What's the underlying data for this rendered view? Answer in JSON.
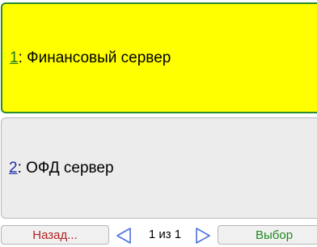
{
  "items": [
    {
      "number": "1",
      "separator": ":",
      "label": "Финансовый сервер",
      "selected": true
    },
    {
      "number": "2",
      "separator": ":",
      "label": "ОФД сервер",
      "selected": false
    }
  ],
  "footer": {
    "back_label": "Назад...",
    "page_indicator": "1 из 1",
    "select_label": "Выбор"
  },
  "colors": {
    "selected_background": "#ffff00",
    "selected_border": "#2a8c2a",
    "item_background": "#ececec",
    "back_text": "#b22222",
    "select_text": "#1f8a1f",
    "arrow": "#4a6fe0"
  },
  "icons": {
    "previous": "triangle-left-icon",
    "next": "triangle-right-icon"
  }
}
